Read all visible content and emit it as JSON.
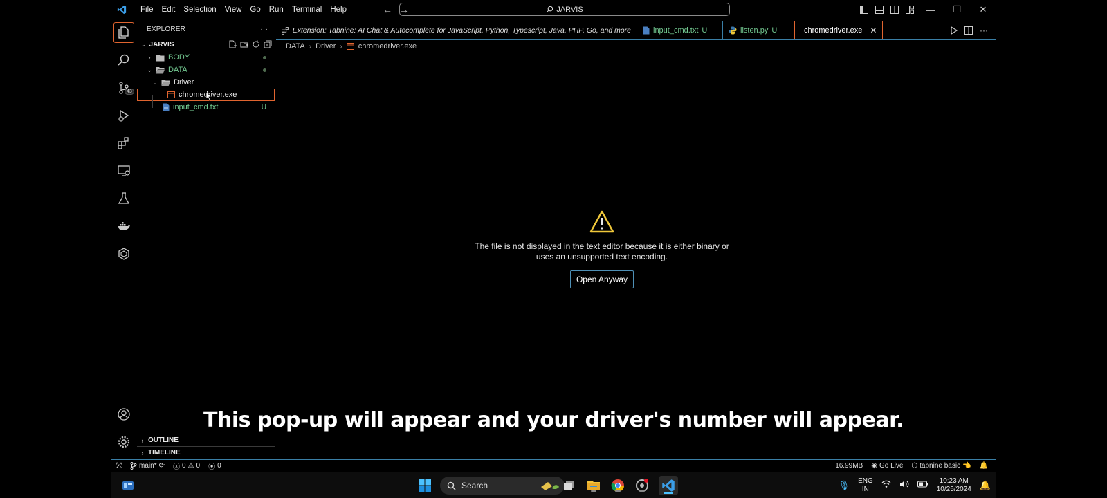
{
  "titlebar": {
    "menu": [
      "File",
      "Edit",
      "Selection",
      "View",
      "Go",
      "Run",
      "Terminal",
      "Help"
    ],
    "command_center": "JARVIS"
  },
  "activity": {
    "source_control_badge": "43"
  },
  "explorer": {
    "header": "EXPLORER",
    "project": "JARVIS",
    "tree": [
      {
        "label": "BODY",
        "type": "folder",
        "collapsed": true
      },
      {
        "label": "DATA",
        "type": "folder",
        "collapsed": false
      },
      {
        "label": "Driver",
        "type": "folder",
        "collapsed": false
      },
      {
        "label": "chromedriver.exe",
        "type": "file",
        "selected": true
      },
      {
        "label": "input_cmd.txt",
        "type": "file",
        "status": "U"
      }
    ],
    "outline": "OUTLINE",
    "timeline": "TIMELINE"
  },
  "tabs": [
    {
      "label": "Extension: Tabnine: AI Chat & Autocomplete for JavaScript, Python, Typescript, Java, PHP, Go, and more",
      "status": ""
    },
    {
      "label": "input_cmd.txt",
      "status": "U"
    },
    {
      "label": "listen.py",
      "status": "U"
    },
    {
      "label": "chromedriver.exe",
      "status": "",
      "active": true
    }
  ],
  "breadcrumb": [
    "DATA",
    "Driver",
    "chromedriver.exe"
  ],
  "editor": {
    "message_line1": "The file is not displayed in the text editor because it is either binary or",
    "message_line2": "uses an unsupported text encoding.",
    "open_button": "Open Anyway"
  },
  "caption": "This pop-up will appear and your driver's number will appear.",
  "statusbar": {
    "branch": "main*",
    "errors": "0",
    "warnings": "0",
    "ports": "0",
    "memory": "16.99MB",
    "go_live": "Go Live",
    "tabnine": "tabnine basic"
  },
  "taskbar": {
    "search_label": "Search",
    "lang_line1": "ENG",
    "lang_line2": "IN",
    "time": "10:23 AM",
    "date": "10/25/2024"
  },
  "colors": {
    "accent_border": "#e0642f",
    "panel_border": "#3a7fa6",
    "untracked": "#73c991"
  }
}
